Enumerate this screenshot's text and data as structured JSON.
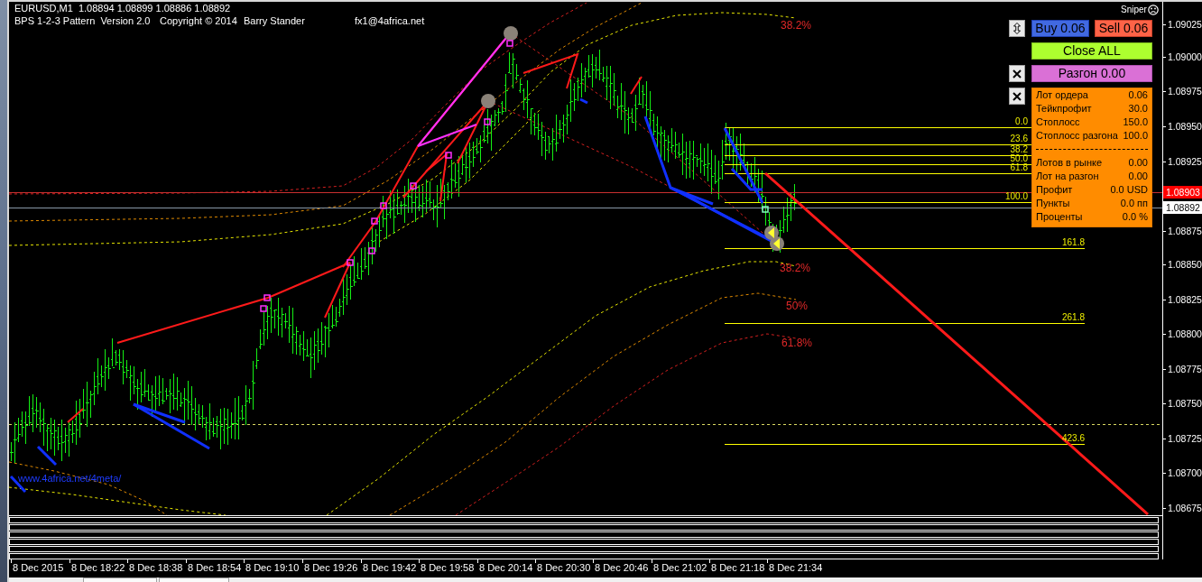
{
  "header": {
    "symbol_line": "EURUSD,M1  1.08894 1.08899 1.08886 1.08892",
    "indicator_info": [
      "BPS 1-2-3 Pattern  Version 2.0",
      "Copyright © 2014",
      "Barry Stander",
      "fx1@4africa.net"
    ]
  },
  "expert": {
    "name": "Sniper"
  },
  "trade_panel": {
    "buy_button": "Buy 0.06",
    "sell_button": "Sell 0.06",
    "close_all_button": "Close ALL",
    "boost_button": "Разгон 0.00",
    "order_settings": [
      {
        "label": "Лот ордера",
        "value": "0.06"
      },
      {
        "label": "Тейкпрофит",
        "value": "30.0"
      },
      {
        "label": "Стоплосс",
        "value": "150.0"
      },
      {
        "label": "Стоплосс разгона",
        "value": "100.0"
      }
    ],
    "market_stats": [
      {
        "label": "Лотов в рынке",
        "value": "0.00"
      },
      {
        "label": "Лот на разгон",
        "value": "0.00"
      },
      {
        "label": "Профит",
        "value": "0.0 USD"
      },
      {
        "label": "Пункты",
        "value": "0.0 пп"
      },
      {
        "label": "Проценты",
        "value": "0.0 %"
      }
    ]
  },
  "fib_levels": [
    {
      "label": "0.0"
    },
    {
      "label": "23.6"
    },
    {
      "label": "38.2"
    },
    {
      "label": "50.0"
    },
    {
      "label": "61.8"
    },
    {
      "label": "100.0"
    },
    {
      "label": "161.8"
    },
    {
      "label": "261.8"
    },
    {
      "label": "423.6"
    }
  ],
  "band_labels": [
    "38.2%",
    "38.2%",
    "50%",
    "61.8%"
  ],
  "chart_link": "www.4africa.net/4meta/",
  "price_axis": {
    "labels": [
      "1.09025",
      "1.09000",
      "1.08975",
      "1.08950",
      "1.08925",
      "1.08875",
      "1.08850",
      "1.08825",
      "1.08800",
      "1.08775",
      "1.08750",
      "1.08725",
      "1.08700",
      "1.08675"
    ],
    "ask_label": "1.08903",
    "bid_label": "1.08892"
  },
  "time_axis": {
    "labels": [
      "8 Dec 2015",
      "8 Dec 18:22",
      "8 Dec 18:38",
      "8 Dec 18:54",
      "8 Dec 19:10",
      "8 Dec 19:26",
      "8 Dec 19:42",
      "8 Dec 19:58",
      "8 Dec 20:14",
      "8 Dec 20:30",
      "8 Dec 20:46",
      "8 Dec 21:02",
      "8 Dec 21:18",
      "8 Dec 21:34"
    ]
  }
}
